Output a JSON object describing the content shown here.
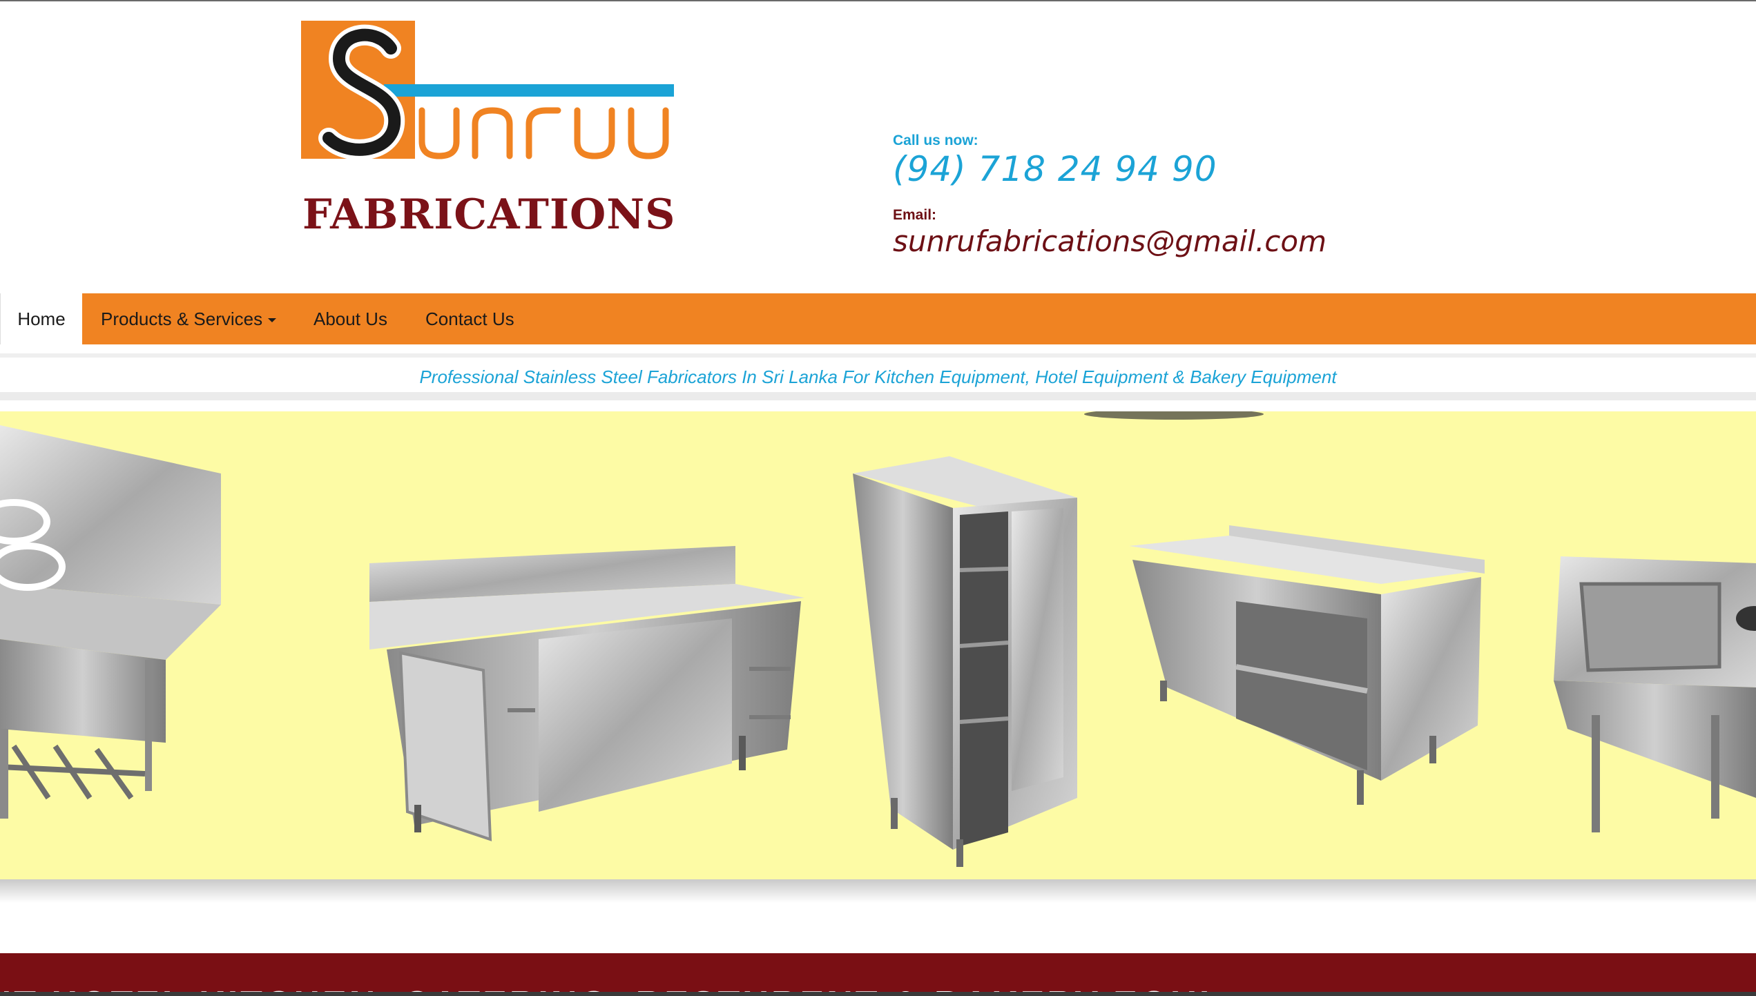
{
  "brand": {
    "logo_script": "unru",
    "logo_word": "FABRICATIONS",
    "colors": {
      "orange": "#f08322",
      "blue": "#1ba3d6",
      "maroon": "#7b1218",
      "banner_bg": "#fdfba5"
    }
  },
  "contact": {
    "call_label": "Call us now:",
    "phone": "(94) 718 24 94 90",
    "email_label": "Email:",
    "email": "sunrufabrications@gmail.com"
  },
  "nav": {
    "items": [
      {
        "label": "Home",
        "active": true
      },
      {
        "label": "Products & Services",
        "dropdown": true
      },
      {
        "label": "About Us"
      },
      {
        "label": "Contact Us"
      }
    ]
  },
  "tagline": "Professional Stainless Steel Fabricators In Sri Lanka For Kitchen Equipment, Hotel Equipment & Bakery Equipment",
  "banner": {
    "products": [
      "stove-counter",
      "sliding-door-cabinet",
      "tall-storage-cabinet",
      "open-shelf-cabinet",
      "sink-unit"
    ]
  },
  "bottom_strip": {
    "text": "ENT    HOTEL KITCHEN, CATERING, RESTURENT & BAKERY EQUI"
  }
}
